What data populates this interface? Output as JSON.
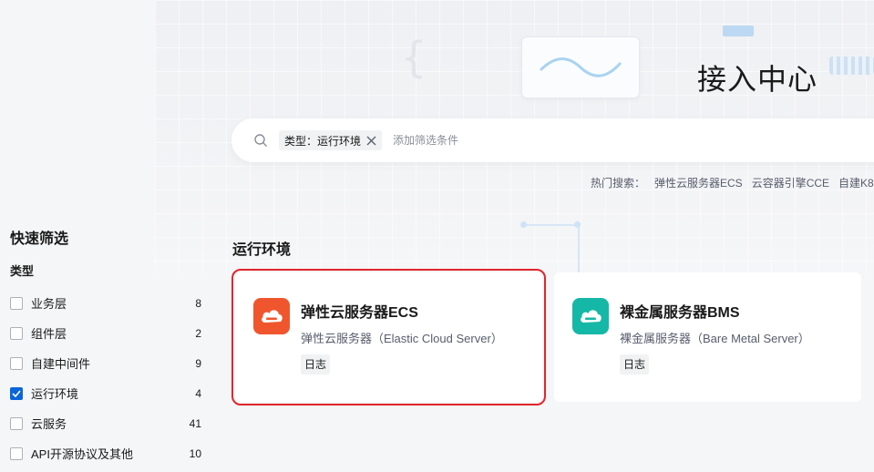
{
  "header": {
    "title": "接入中心"
  },
  "search": {
    "active_filter": "类型：运行环境",
    "placeholder": "添加筛选条件",
    "hot_label": "热门搜索：",
    "hot_items": [
      "弹性云服务器ECS",
      "云容器引擎CCE",
      "自建K8"
    ]
  },
  "sidebar": {
    "title": "快速筛选",
    "group_label": "类型",
    "items": [
      {
        "label": "业务层",
        "count": "8",
        "checked": false
      },
      {
        "label": "组件层",
        "count": "2",
        "checked": false
      },
      {
        "label": "自建中间件",
        "count": "9",
        "checked": false
      },
      {
        "label": "运行环境",
        "count": "4",
        "checked": true
      },
      {
        "label": "云服务",
        "count": "41",
        "checked": false
      },
      {
        "label": "API开源协议及其他",
        "count": "10",
        "checked": false
      }
    ]
  },
  "main": {
    "section_title": "运行环境",
    "cards": [
      {
        "title": "弹性云服务器ECS",
        "description": "弹性云服务器（Elastic Cloud Server）",
        "tag": "日志",
        "icon": "cloud-server-icon",
        "icon_color": "#f0562d"
      },
      {
        "title": "裸金属服务器BMS",
        "description": "裸金属服务器（Bare Metal Server）",
        "tag": "日志",
        "icon": "cloud-server-icon",
        "icon_color": "#15b8a6"
      }
    ]
  },
  "colors": {
    "accent": "#0a66d8",
    "highlight_border": "#e0262b"
  }
}
